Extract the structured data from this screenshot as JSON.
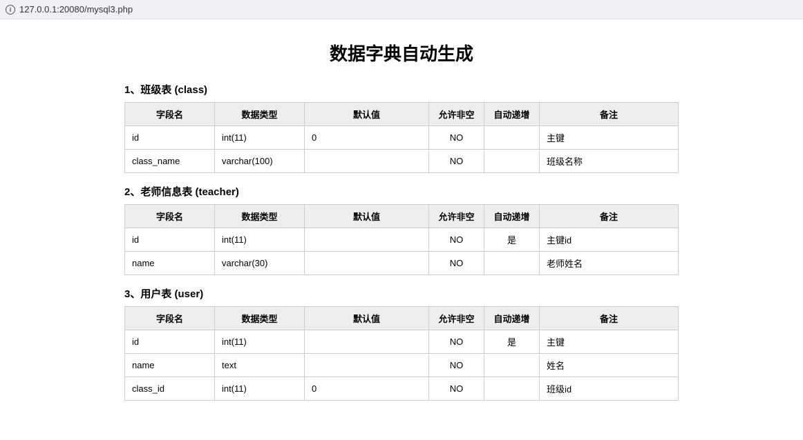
{
  "browser": {
    "url": "127.0.0.1:20080/mysql3.php"
  },
  "page_title": "数据字典自动生成",
  "columns": {
    "field": "字段名",
    "type": "数据类型",
    "default": "默认值",
    "nullable": "允许非空",
    "auto_inc": "自动递增",
    "remark": "备注"
  },
  "tables": [
    {
      "heading": "1、班级表 (class)",
      "rows": [
        {
          "field": "id",
          "type": "int(11)",
          "default": "0",
          "nullable": "NO",
          "auto_inc": "",
          "remark": "主键"
        },
        {
          "field": "class_name",
          "type": "varchar(100)",
          "default": "",
          "nullable": "NO",
          "auto_inc": "",
          "remark": "班级名称"
        }
      ]
    },
    {
      "heading": "2、老师信息表 (teacher)",
      "rows": [
        {
          "field": "id",
          "type": "int(11)",
          "default": "",
          "nullable": "NO",
          "auto_inc": "是",
          "remark": "主键id"
        },
        {
          "field": "name",
          "type": "varchar(30)",
          "default": "",
          "nullable": "NO",
          "auto_inc": "",
          "remark": "老师姓名"
        }
      ]
    },
    {
      "heading": "3、用户表 (user)",
      "rows": [
        {
          "field": "id",
          "type": "int(11)",
          "default": "",
          "nullable": "NO",
          "auto_inc": "是",
          "remark": "主键"
        },
        {
          "field": "name",
          "type": "text",
          "default": "",
          "nullable": "NO",
          "auto_inc": "",
          "remark": "姓名"
        },
        {
          "field": "class_id",
          "type": "int(11)",
          "default": "0",
          "nullable": "NO",
          "auto_inc": "",
          "remark": "班级id"
        }
      ]
    }
  ]
}
